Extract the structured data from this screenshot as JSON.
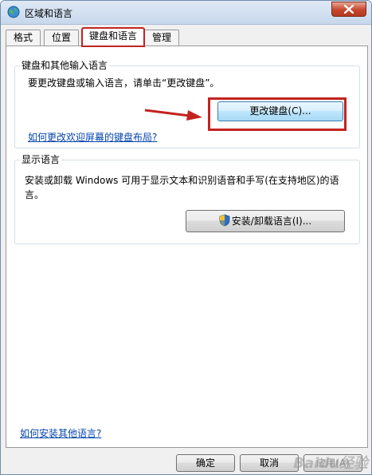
{
  "window": {
    "title": "区域和语言"
  },
  "tabs": [
    {
      "label": "格式"
    },
    {
      "label": "位置"
    },
    {
      "label": "键盘和语言",
      "active": true
    },
    {
      "label": "管理"
    }
  ],
  "keyboard_group": {
    "legend": "键盘和其他输入语言",
    "description": "要更改键盘或输入语言，请单击“更改键盘”。",
    "button_label": "更改键盘(C)...",
    "link": "如何更改欢迎屏幕的键盘布局?"
  },
  "display_group": {
    "legend": "显示语言",
    "description": "安装或卸载 Windows 可用于显示文本和识别语音和手写(在支持地区)的语言。",
    "button_label": "安装/卸载语言(I)..."
  },
  "bottom_link": "如何安装其他语言?",
  "footer": {
    "ok": "确定",
    "cancel": "取消",
    "apply": "应用(A)"
  },
  "watermark": "Baidu经验",
  "colors": {
    "highlight": "#c3231f",
    "link": "#0645ad"
  }
}
